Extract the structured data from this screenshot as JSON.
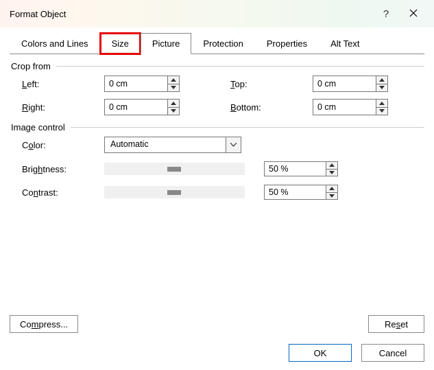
{
  "title": "Format Object",
  "tabs": {
    "colors": "Colors and Lines",
    "size": "Size",
    "picture": "Picture",
    "protection": "Protection",
    "properties": "Properties",
    "alttext": "Alt Text"
  },
  "groups": {
    "crop": "Crop from",
    "image": "Image control"
  },
  "crop": {
    "left_label_pre": "",
    "left_label": "L",
    "left_label_post": "eft:",
    "right_label_pre": "",
    "right_label": "R",
    "right_label_post": "ight:",
    "top_label_pre": "",
    "top_label": "T",
    "top_label_post": "op:",
    "bottom_label_pre": "",
    "bottom_label": "B",
    "bottom_label_post": "ottom:",
    "left": "0 cm",
    "right": "0 cm",
    "top": "0 cm",
    "bottom": "0 cm"
  },
  "image": {
    "color_label_pre": "C",
    "color_label_u": "o",
    "color_label_post": "lor:",
    "color": "Automatic",
    "brightness_label_pre": "Brig",
    "brightness_label_u": "h",
    "brightness_label_post": "tness:",
    "brightness": "50 %",
    "contrast_label_pre": "Co",
    "contrast_label_u": "n",
    "contrast_label_post": "trast:",
    "contrast": "50 %"
  },
  "buttons": {
    "compress_pre": "Co",
    "compress_u": "m",
    "compress_post": "press...",
    "reset_pre": "Re",
    "reset_u": "s",
    "reset_post": "et",
    "ok": "OK",
    "cancel": "Cancel"
  }
}
